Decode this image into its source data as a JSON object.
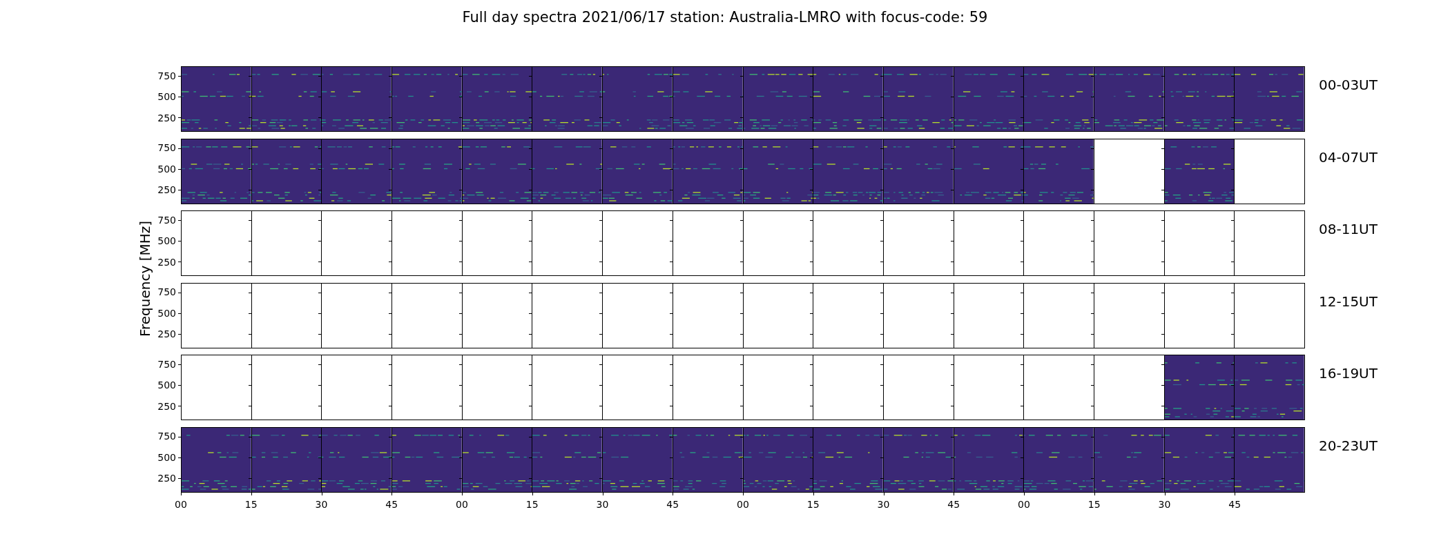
{
  "title": "Full day spectra 2021/06/17 station: Australia-LMRO with focus-code: 59",
  "ylabel": "Frequency [MHz]",
  "rows": [
    {
      "label": "00-03UT",
      "yticks": [
        "750",
        "500",
        "250"
      ],
      "panels": [
        {
          "has_data": true
        },
        {
          "has_data": true
        },
        {
          "has_data": true
        },
        {
          "has_data": true
        },
        {
          "has_data": true
        },
        {
          "has_data": true
        },
        {
          "has_data": true
        },
        {
          "has_data": true
        },
        {
          "has_data": true
        },
        {
          "has_data": true
        },
        {
          "has_data": true
        },
        {
          "has_data": true
        },
        {
          "has_data": true
        },
        {
          "has_data": true
        },
        {
          "has_data": true
        },
        {
          "has_data": true
        }
      ]
    },
    {
      "label": "04-07UT",
      "yticks": [
        "750",
        "500",
        "250"
      ],
      "panels": [
        {
          "has_data": true
        },
        {
          "has_data": true
        },
        {
          "has_data": true
        },
        {
          "has_data": true
        },
        {
          "has_data": true
        },
        {
          "has_data": true
        },
        {
          "has_data": true
        },
        {
          "has_data": true
        },
        {
          "has_data": true
        },
        {
          "has_data": true
        },
        {
          "has_data": true
        },
        {
          "has_data": true
        },
        {
          "has_data": true
        },
        {
          "has_data": false
        },
        {
          "has_data": true
        },
        {
          "has_data": false
        }
      ]
    },
    {
      "label": "08-11UT",
      "yticks": [
        "750",
        "500",
        "250"
      ],
      "panels": [
        {
          "has_data": false
        },
        {
          "has_data": false
        },
        {
          "has_data": false
        },
        {
          "has_data": false
        },
        {
          "has_data": false
        },
        {
          "has_data": false
        },
        {
          "has_data": false
        },
        {
          "has_data": false
        },
        {
          "has_data": false
        },
        {
          "has_data": false
        },
        {
          "has_data": false
        },
        {
          "has_data": false
        },
        {
          "has_data": false
        },
        {
          "has_data": false
        },
        {
          "has_data": false
        },
        {
          "has_data": false
        }
      ]
    },
    {
      "label": "12-15UT",
      "yticks": [
        "750",
        "500",
        "250"
      ],
      "panels": [
        {
          "has_data": false
        },
        {
          "has_data": false
        },
        {
          "has_data": false
        },
        {
          "has_data": false
        },
        {
          "has_data": false
        },
        {
          "has_data": false
        },
        {
          "has_data": false
        },
        {
          "has_data": false
        },
        {
          "has_data": false
        },
        {
          "has_data": false
        },
        {
          "has_data": false
        },
        {
          "has_data": false
        },
        {
          "has_data": false
        },
        {
          "has_data": false
        },
        {
          "has_data": false
        },
        {
          "has_data": false
        }
      ]
    },
    {
      "label": "16-19UT",
      "yticks": [
        "750",
        "500",
        "250"
      ],
      "panels": [
        {
          "has_data": false
        },
        {
          "has_data": false
        },
        {
          "has_data": false
        },
        {
          "has_data": false
        },
        {
          "has_data": false
        },
        {
          "has_data": false
        },
        {
          "has_data": false
        },
        {
          "has_data": false
        },
        {
          "has_data": false
        },
        {
          "has_data": false
        },
        {
          "has_data": false
        },
        {
          "has_data": false
        },
        {
          "has_data": false
        },
        {
          "has_data": false
        },
        {
          "has_data": true
        },
        {
          "has_data": true
        }
      ]
    },
    {
      "label": "20-23UT",
      "yticks": [
        "750",
        "500",
        "250"
      ],
      "panels": [
        {
          "has_data": true
        },
        {
          "has_data": true
        },
        {
          "has_data": true
        },
        {
          "has_data": true
        },
        {
          "has_data": true
        },
        {
          "has_data": true
        },
        {
          "has_data": true
        },
        {
          "has_data": true
        },
        {
          "has_data": true
        },
        {
          "has_data": true
        },
        {
          "has_data": true
        },
        {
          "has_data": true
        },
        {
          "has_data": true
        },
        {
          "has_data": true
        },
        {
          "has_data": true
        },
        {
          "has_data": true
        }
      ]
    }
  ],
  "xticks": [
    "00",
    "15",
    "30",
    "45",
    "00",
    "15",
    "30",
    "45",
    "00",
    "15",
    "30",
    "45",
    "00",
    "15",
    "30",
    "45"
  ]
}
